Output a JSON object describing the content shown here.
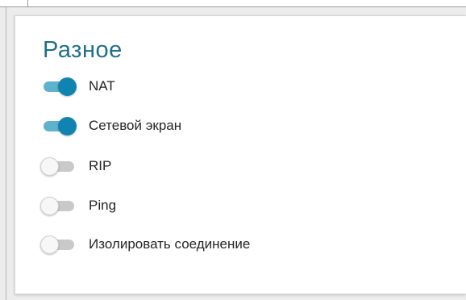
{
  "section": {
    "title": "Разное",
    "toggles": [
      {
        "label": "NAT",
        "on": true
      },
      {
        "label": "Сетевой экран",
        "on": true
      },
      {
        "label": "RIP",
        "on": false
      },
      {
        "label": "Ping",
        "on": false
      },
      {
        "label": "Изолировать соединение",
        "on": false
      }
    ]
  },
  "colors": {
    "accent": "#0f84b0",
    "track_on": "#5fb1cc",
    "title": "#1e6f8a"
  }
}
